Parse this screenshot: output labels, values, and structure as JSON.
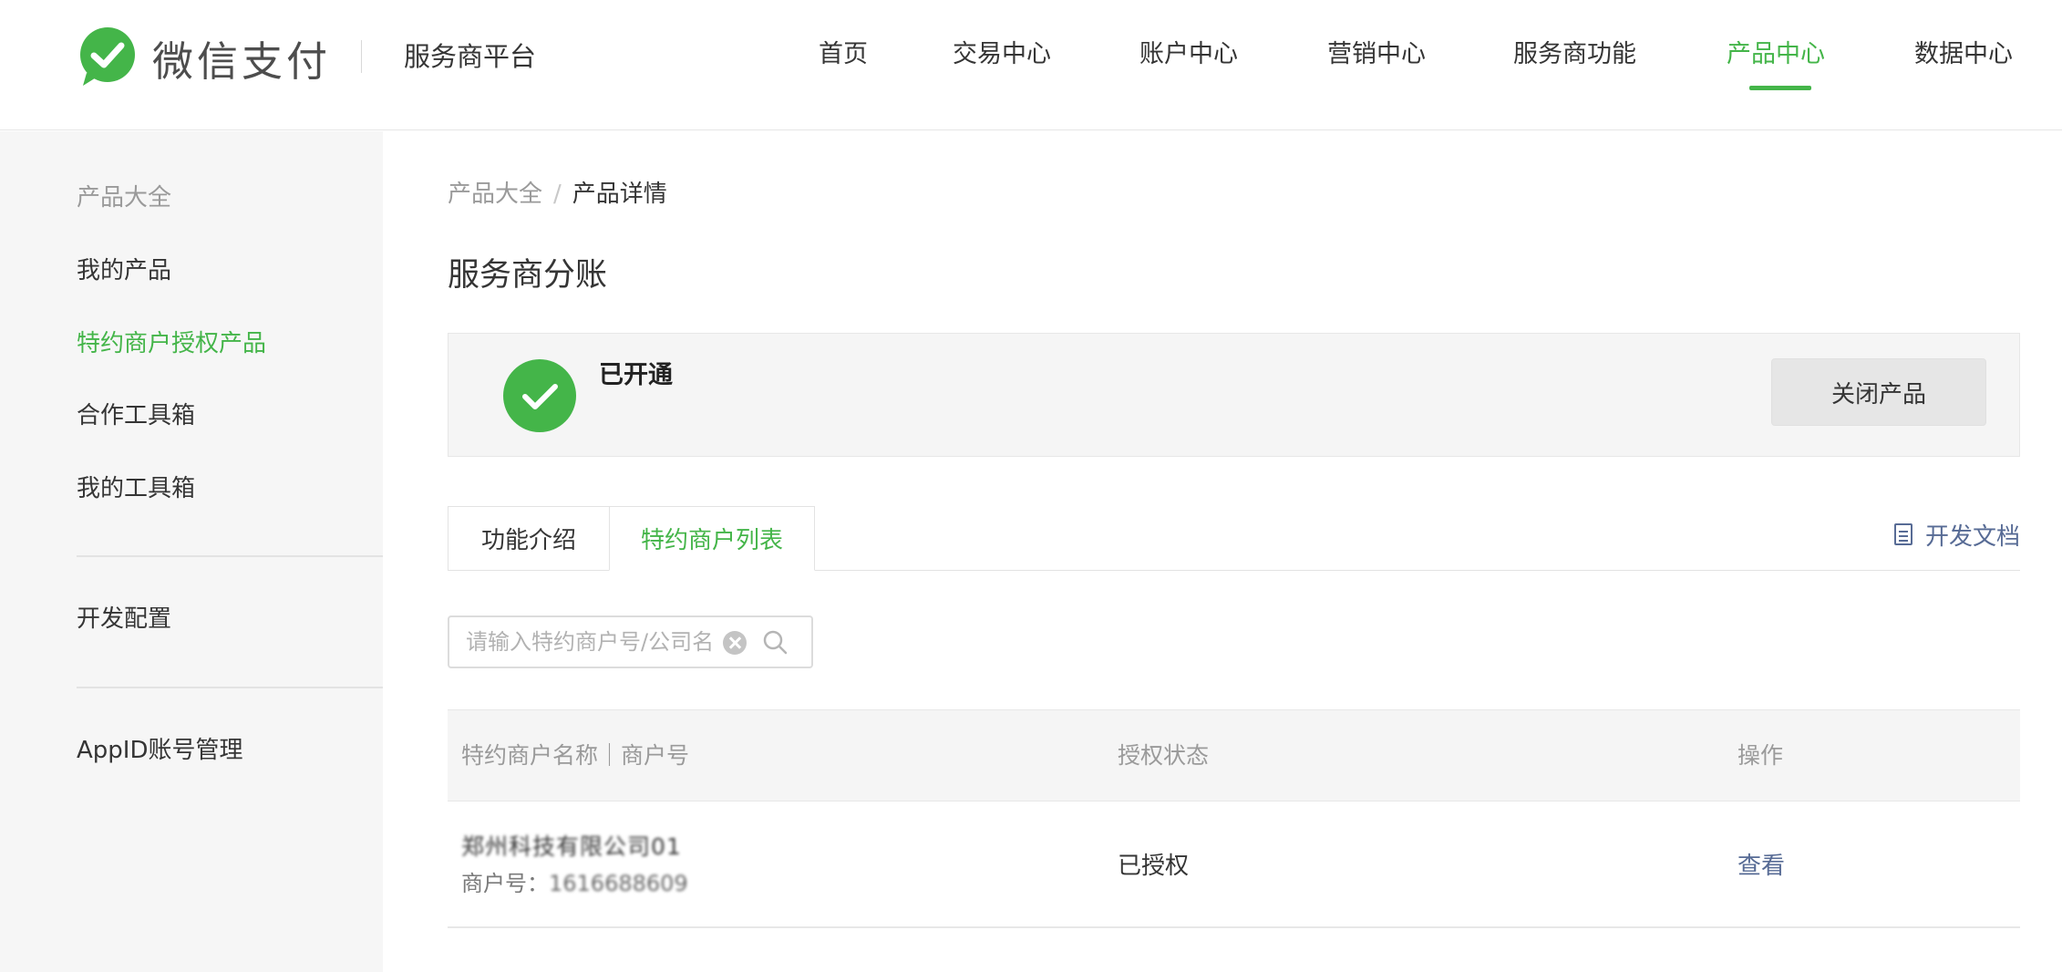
{
  "header": {
    "brand": "微信支付",
    "platform": "服务商平台",
    "nav": [
      {
        "label": "首页",
        "active": false
      },
      {
        "label": "交易中心",
        "active": false
      },
      {
        "label": "账户中心",
        "active": false
      },
      {
        "label": "营销中心",
        "active": false
      },
      {
        "label": "服务商功能",
        "active": false
      },
      {
        "label": "产品中心",
        "active": true
      },
      {
        "label": "数据中心",
        "active": false
      }
    ]
  },
  "sidebar": {
    "section_title": "产品大全",
    "items": [
      {
        "label": "我的产品"
      },
      {
        "label": "特约商户授权产品",
        "active": true
      },
      {
        "label": "合作工具箱"
      },
      {
        "label": "我的工具箱"
      },
      {
        "label": "开发配置"
      },
      {
        "label": "AppID账号管理"
      }
    ]
  },
  "breadcrumb": {
    "parent": "产品大全",
    "separator": "/",
    "current": "产品详情"
  },
  "page": {
    "title": "服务商分账"
  },
  "status": {
    "text": "已开通",
    "close_button": "关闭产品"
  },
  "tabs": [
    {
      "label": "功能介绍",
      "active": false
    },
    {
      "label": "特约商户列表",
      "active": true
    }
  ],
  "dev_doc": "开发文档",
  "search": {
    "placeholder": "请输入特约商户号/公司名称",
    "value": ""
  },
  "table": {
    "columns": [
      "特约商户名称｜商户号",
      "授权状态",
      "操作"
    ],
    "rows": [
      {
        "name": "郑州科技有限公司01",
        "merchant_id_label": "商户号：",
        "merchant_id": "1616688609",
        "status": "已授权",
        "action": "查看"
      }
    ]
  },
  "colors": {
    "accent": "#44b549",
    "link": "#576b95"
  }
}
